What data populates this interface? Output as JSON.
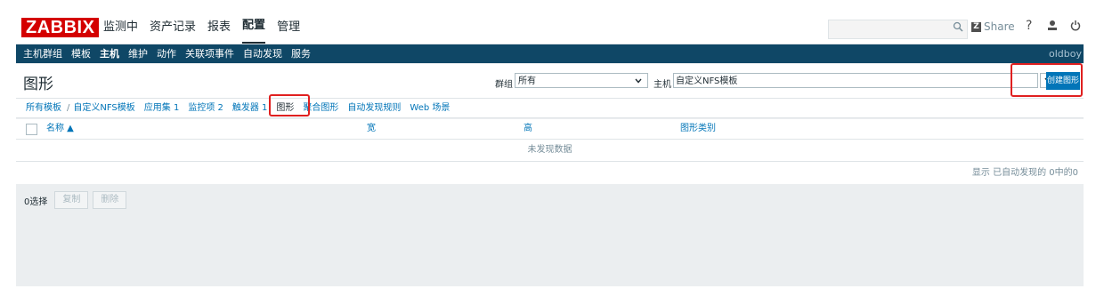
{
  "logo": "ZABBIX",
  "top_menu": [
    "监测中",
    "资产记录",
    "报表",
    "配置",
    "管理"
  ],
  "top_menu_active": "配置",
  "search": {
    "placeholder": "",
    "icon": "search-icon"
  },
  "share_label": "Share",
  "help_label": "?",
  "sub_menu": [
    "主机群组",
    "模板",
    "主机",
    "维护",
    "动作",
    "关联项事件",
    "自动发现",
    "服务"
  ],
  "sub_menu_active": "主机",
  "user": "oldboy",
  "page_title": "图形",
  "filter": {
    "group_label": "群组",
    "group_value": "所有",
    "host_label": "主机",
    "host_value": "自定义NFS模板"
  },
  "create_button": "创建图形",
  "tabs": {
    "all_templates": "所有模板",
    "separator": "/",
    "template": "自定义NFS模板",
    "apps": "应用集 1",
    "items": "监控项 2",
    "triggers": "触发器 1",
    "graphs": "图形",
    "screens": "聚合图形",
    "discovery": "自动发现规则",
    "web": "Web 场景"
  },
  "table": {
    "columns": {
      "name": "名称 ▲",
      "width": "宽",
      "height": "高",
      "type": "图形类别"
    },
    "empty_message": "未发现数据"
  },
  "footer_info": "显示 已自动发现的 0中的0",
  "mass_actions": {
    "selected": "0选择",
    "copy": "复制",
    "delete": "删除"
  },
  "colors": {
    "brand_red": "#d40000",
    "nav_blue": "#0f4766",
    "accent_blue": "#0275b8",
    "highlight_red": "#e02020"
  }
}
